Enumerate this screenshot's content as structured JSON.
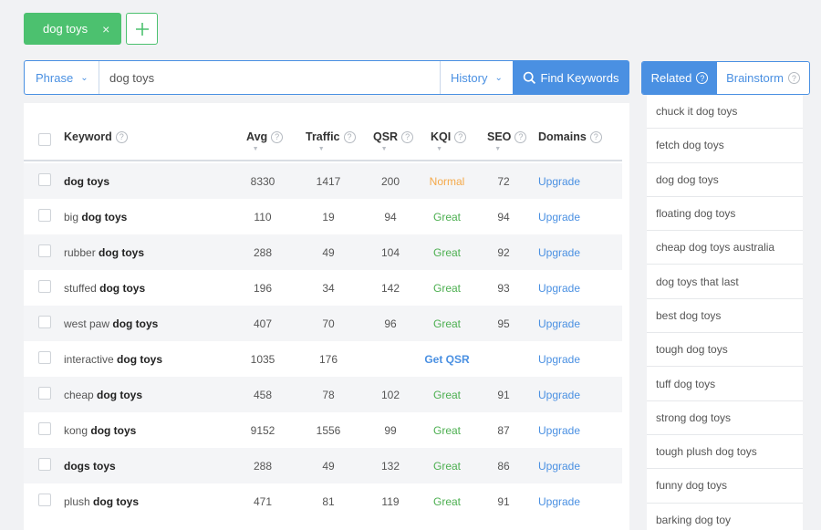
{
  "tag": {
    "label": "dog toys",
    "close": "×"
  },
  "add_button": {
    "label": "+"
  },
  "search": {
    "mode": "Phrase",
    "value": "dog toys",
    "history": "History",
    "find": "Find Keywords"
  },
  "columns": {
    "keyword": "Keyword",
    "avg": "Avg",
    "traffic": "Traffic",
    "qsr": "QSR",
    "kqi": "KQI",
    "seo": "SEO",
    "domains": "Domains"
  },
  "rows": [
    {
      "pre": "",
      "bold": "dog toys",
      "avg": "8330",
      "traffic": "1417",
      "qsr": "200",
      "kqi": "Normal",
      "kqi_type": "normal",
      "seo": "72",
      "domains": "Upgrade"
    },
    {
      "pre": "big ",
      "bold": "dog toys",
      "avg": "110",
      "traffic": "19",
      "qsr": "94",
      "kqi": "Great",
      "kqi_type": "great",
      "seo": "94",
      "domains": "Upgrade"
    },
    {
      "pre": "rubber ",
      "bold": "dog toys",
      "avg": "288",
      "traffic": "49",
      "qsr": "104",
      "kqi": "Great",
      "kqi_type": "great",
      "seo": "92",
      "domains": "Upgrade"
    },
    {
      "pre": "stuffed ",
      "bold": "dog toys",
      "avg": "196",
      "traffic": "34",
      "qsr": "142",
      "kqi": "Great",
      "kqi_type": "great",
      "seo": "93",
      "domains": "Upgrade"
    },
    {
      "pre": "west paw ",
      "bold": "dog toys",
      "avg": "407",
      "traffic": "70",
      "qsr": "96",
      "kqi": "Great",
      "kqi_type": "great",
      "seo": "95",
      "domains": "Upgrade"
    },
    {
      "pre": "interactive ",
      "bold": "dog toys",
      "avg": "1035",
      "traffic": "176",
      "qsr": "",
      "kqi": "Get QSR",
      "kqi_type": "getqsr",
      "seo": "",
      "domains": "Upgrade"
    },
    {
      "pre": "cheap ",
      "bold": "dog toys",
      "avg": "458",
      "traffic": "78",
      "qsr": "102",
      "kqi": "Great",
      "kqi_type": "great",
      "seo": "91",
      "domains": "Upgrade"
    },
    {
      "pre": "kong ",
      "bold": "dog toys",
      "avg": "9152",
      "traffic": "1556",
      "qsr": "99",
      "kqi": "Great",
      "kqi_type": "great",
      "seo": "87",
      "domains": "Upgrade"
    },
    {
      "pre": "",
      "bold": "dogs toys",
      "avg": "288",
      "traffic": "49",
      "qsr": "132",
      "kqi": "Great",
      "kqi_type": "great",
      "seo": "86",
      "domains": "Upgrade"
    },
    {
      "pre": "plush ",
      "bold": "dog toys",
      "avg": "471",
      "traffic": "81",
      "qsr": "119",
      "kqi": "Great",
      "kqi_type": "great",
      "seo": "91",
      "domains": "Upgrade"
    }
  ],
  "side_tabs": {
    "related": "Related",
    "brainstorm": "Brainstorm"
  },
  "related": [
    "chuck it dog toys",
    "fetch dog toys",
    "dog dog toys",
    "floating dog toys",
    "cheap dog toys australia",
    "dog toys that last",
    "best dog toys",
    "tough dog toys",
    "tuff dog toys",
    "strong dog toys",
    "tough plush dog toys",
    "funny dog toys",
    "barking dog toy"
  ],
  "colors": {
    "accent": "#4a90e2",
    "green": "#4cc16f",
    "great": "#4caf50",
    "normal": "#f5a94a"
  },
  "icons": {
    "help": "question-circle-icon",
    "search": "search-icon",
    "chevron": "chevron-down-icon",
    "close": "close-icon",
    "plus": "plus-icon"
  }
}
